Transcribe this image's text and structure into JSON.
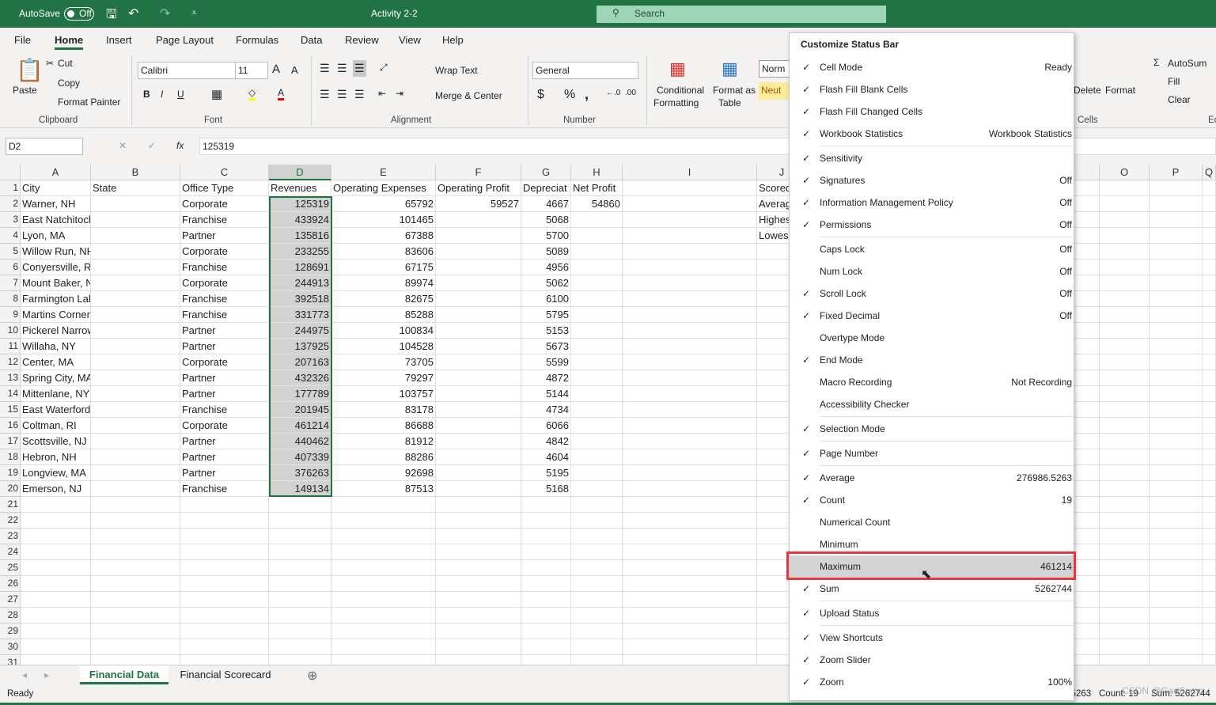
{
  "titlebar": {
    "autosave": "AutoSave",
    "autosave_state": "Off",
    "title": "Activity 2-2",
    "search": "Search"
  },
  "menutabs": [
    "File",
    "Home",
    "Insert",
    "Page Layout",
    "Formulas",
    "Data",
    "Review",
    "View",
    "Help"
  ],
  "ribbon": {
    "paste": "Paste",
    "cut": "Cut",
    "copy": "Copy",
    "format_painter": "Format Painter",
    "clipboard": "Clipboard",
    "font_name": "Calibri",
    "font_size": "11",
    "font": "Font",
    "wrap_text": "Wrap Text",
    "merge_center": "Merge & Center",
    "alignment": "Alignment",
    "number_format": "General",
    "number": "Number",
    "conditional": "Conditional",
    "formatting": "Formatting",
    "format_as": "Format as",
    "table": "Table",
    "style_normal": "Norm",
    "style_neutral": "Neut",
    "delete": "Delete",
    "format": "Format",
    "cells": "Cells",
    "autosum": "AutoSum",
    "fill": "Fill",
    "clear": "Clear",
    "edit": "Ec"
  },
  "formula_bar": {
    "name_box": "D2",
    "fx": "fx",
    "value": "125319"
  },
  "columns": [
    "A",
    "B",
    "C",
    "D",
    "E",
    "F",
    "G",
    "H",
    "I",
    "J",
    "",
    "O",
    "P",
    "Q"
  ],
  "rows": [
    [
      "City",
      "State",
      "Office Type",
      "Revenues",
      "Operating Expenses",
      "Operating Profit",
      "Depreciat",
      "Net Profit",
      "",
      "Scored"
    ],
    [
      "Warner, NH",
      "",
      "Corporate",
      "125319",
      "65792",
      "59527",
      "4667",
      "54860",
      "",
      "Averag"
    ],
    [
      "East Natchitoches, RI",
      "",
      "Franchise",
      "433924",
      "101465",
      "",
      "5068",
      "",
      "",
      "Highes"
    ],
    [
      "Lyon, MA",
      "",
      "Partner",
      "135816",
      "67388",
      "",
      "5700",
      "",
      "",
      "Lowes"
    ],
    [
      "Willow Run, NH",
      "",
      "Corporate",
      "233255",
      "83606",
      "",
      "5089"
    ],
    [
      "Conyersville, RI",
      "",
      "Franchise",
      "128691",
      "67175",
      "",
      "4956"
    ],
    [
      "Mount Baker, NY",
      "",
      "Corporate",
      "244913",
      "89974",
      "",
      "5062"
    ],
    [
      "Farmington Lake, RI",
      "",
      "Franchise",
      "392518",
      "82675",
      "",
      "6100"
    ],
    [
      "Martins Corner, NH",
      "",
      "Franchise",
      "331773",
      "85288",
      "",
      "5795"
    ],
    [
      "Pickerel Narrows, ME",
      "",
      "Partner",
      "244975",
      "100834",
      "",
      "5153"
    ],
    [
      "Willaha, NY",
      "",
      "Partner",
      "137925",
      "104528",
      "",
      "5673"
    ],
    [
      "Center, MA",
      "",
      "Corporate",
      "207163",
      "73705",
      "",
      "5599"
    ],
    [
      "Spring City, MA",
      "",
      "Partner",
      "432326",
      "79297",
      "",
      "4872"
    ],
    [
      "Mittenlane, NY",
      "",
      "Partner",
      "177789",
      "103757",
      "",
      "5144"
    ],
    [
      "East Waterford, ME",
      "",
      "Franchise",
      "201945",
      "83178",
      "",
      "4734"
    ],
    [
      "Coltman, RI",
      "",
      "Corporate",
      "461214",
      "86688",
      "",
      "6066"
    ],
    [
      "Scottsville, NJ",
      "",
      "Partner",
      "440462",
      "81912",
      "",
      "4842"
    ],
    [
      "Hebron, NH",
      "",
      "Partner",
      "407339",
      "88286",
      "",
      "4604"
    ],
    [
      "Longview, MA",
      "",
      "Partner",
      "376263",
      "92698",
      "",
      "5195"
    ],
    [
      "Emerson, NJ",
      "",
      "Franchise",
      "149134",
      "87513",
      "",
      "5168"
    ]
  ],
  "sheets": [
    "Financial Data",
    "Financial Scorecard"
  ],
  "status": {
    "ready": "Ready",
    "average": "Average: 276986.5263",
    "count": "Count: 19",
    "sum": "Sum: 5262744",
    "watermark": "CSDN @GodSump"
  },
  "menu": {
    "title": "Customize Status Bar",
    "items": [
      {
        "label": "Cell Mode",
        "value": "Ready",
        "checked": true
      },
      {
        "label": "Flash Fill Blank Cells",
        "value": "",
        "checked": true
      },
      {
        "label": "Flash Fill Changed Cells",
        "value": "",
        "checked": true
      },
      {
        "label": "Workbook Statistics",
        "value": "Workbook Statistics",
        "checked": true,
        "sep": true
      },
      {
        "label": "Sensitivity",
        "value": "",
        "checked": true
      },
      {
        "label": "Signatures",
        "value": "Off",
        "checked": true
      },
      {
        "label": "Information Management Policy",
        "value": "Off",
        "checked": true
      },
      {
        "label": "Permissions",
        "value": "Off",
        "checked": true,
        "sep": true
      },
      {
        "label": "Caps Lock",
        "value": "Off",
        "checked": false
      },
      {
        "label": "Num Lock",
        "value": "Off",
        "checked": false
      },
      {
        "label": "Scroll Lock",
        "value": "Off",
        "checked": true
      },
      {
        "label": "Fixed Decimal",
        "value": "Off",
        "checked": true
      },
      {
        "label": "Overtype Mode",
        "value": "",
        "checked": false
      },
      {
        "label": "End Mode",
        "value": "",
        "checked": true
      },
      {
        "label": "Macro Recording",
        "value": "Not Recording",
        "checked": false
      },
      {
        "label": "Accessibility Checker",
        "value": "",
        "checked": false,
        "sep": true
      },
      {
        "label": "Selection Mode",
        "value": "",
        "checked": true,
        "sep": true
      },
      {
        "label": "Page Number",
        "value": "",
        "checked": true,
        "sep": true
      },
      {
        "label": "Average",
        "value": "276986.5263",
        "checked": true
      },
      {
        "label": "Count",
        "value": "19",
        "checked": true
      },
      {
        "label": "Numerical Count",
        "value": "",
        "checked": false
      },
      {
        "label": "Minimum",
        "value": "",
        "checked": false
      },
      {
        "label": "Maximum",
        "value": "461214",
        "checked": false,
        "highlighted": true
      },
      {
        "label": "Sum",
        "value": "5262744",
        "checked": true,
        "sep": true
      },
      {
        "label": "Upload Status",
        "value": "",
        "checked": true,
        "sep": true
      },
      {
        "label": "View Shortcuts",
        "value": "",
        "checked": true
      },
      {
        "label": "Zoom Slider",
        "value": "",
        "checked": true
      },
      {
        "label": "Zoom",
        "value": "100%",
        "checked": true
      }
    ]
  },
  "colors": {
    "brand": "#217346",
    "highlight_border": "#e8373f"
  }
}
